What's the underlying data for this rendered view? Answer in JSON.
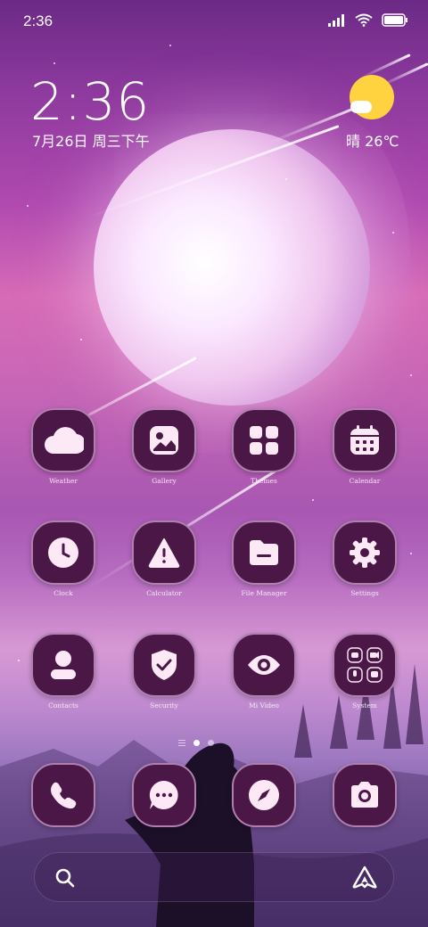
{
  "status_bar": {
    "time": "2:36"
  },
  "clock_widget": {
    "time": "2:36",
    "date": "7月26日 周三下午"
  },
  "weather_widget": {
    "text": "晴 26℃",
    "icon": "sunny-cloud-icon",
    "sun_color": "#ffd23f"
  },
  "apps": [
    {
      "label": "Weather",
      "icon": "weather-icon"
    },
    {
      "label": "Gallery",
      "icon": "gallery-icon"
    },
    {
      "label": "Themes",
      "icon": "themes-icon"
    },
    {
      "label": "Calendar",
      "icon": "calendar-icon"
    },
    {
      "label": "Clock",
      "icon": "clock-icon"
    },
    {
      "label": "Calculator",
      "icon": "calculator-icon"
    },
    {
      "label": "File Manager",
      "icon": "folder-icon"
    },
    {
      "label": "Settings",
      "icon": "gear-icon"
    },
    {
      "label": "Contacts",
      "icon": "contacts-icon"
    },
    {
      "label": "Security",
      "icon": "shield-icon"
    },
    {
      "label": "Mi Video",
      "icon": "eye-icon"
    },
    {
      "label": "System",
      "icon": "system-folder-icon"
    }
  ],
  "dock": [
    {
      "icon": "phone-icon"
    },
    {
      "icon": "messages-icon"
    },
    {
      "icon": "compass-icon"
    },
    {
      "icon": "camera-icon"
    }
  ],
  "page_indicator": {
    "pages": 2,
    "current": 1
  },
  "colors": {
    "icon_bg": "#4a1747",
    "icon_border": "#b07fb0",
    "glyph": "#fde8f6"
  }
}
